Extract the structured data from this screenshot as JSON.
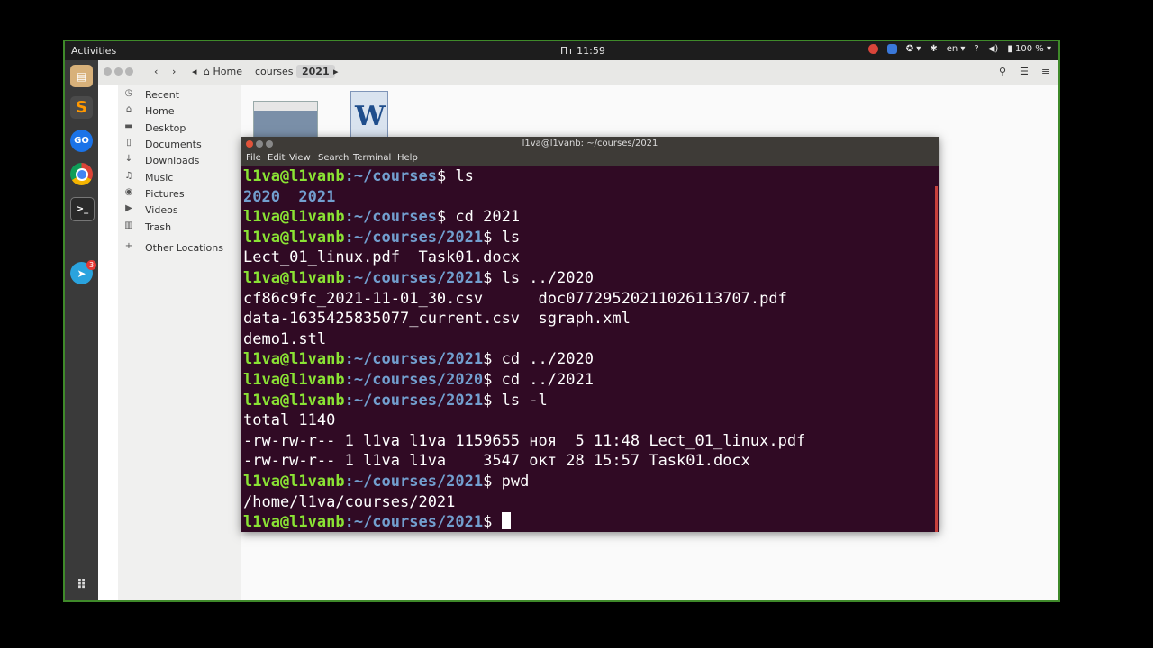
{
  "topbar": {
    "activities": "Activities",
    "clock": "Пт 11:59",
    "lang": "en",
    "help": "?",
    "battery": "100 %",
    "badge_count": "3"
  },
  "dock": {
    "telegram_badge": "3",
    "apps": [
      "files",
      "sublime-text",
      "goland",
      "chrome",
      "terminal",
      "telegram"
    ]
  },
  "files": {
    "nav": {
      "home": "Home",
      "crumbs": [
        "courses",
        "2021"
      ]
    },
    "sidebar": {
      "items": [
        {
          "label": "Recent",
          "icon": "clock-icon"
        },
        {
          "label": "Home",
          "icon": "home-icon"
        },
        {
          "label": "Desktop",
          "icon": "folder-icon"
        },
        {
          "label": "Documents",
          "icon": "document-icon"
        },
        {
          "label": "Downloads",
          "icon": "download-icon"
        },
        {
          "label": "Music",
          "icon": "music-icon"
        },
        {
          "label": "Pictures",
          "icon": "camera-icon"
        },
        {
          "label": "Videos",
          "icon": "video-icon"
        },
        {
          "label": "Trash",
          "icon": "trash-icon"
        }
      ],
      "other": "Other Locations"
    }
  },
  "terminal": {
    "title": "l1va@l1vanb: ~/courses/2021",
    "menu": [
      "File",
      "Edit",
      "View",
      "Search",
      "Terminal",
      "Help"
    ],
    "user": "l1va@l1vanb",
    "lines": [
      {
        "path": ":~/courses",
        "cmd": "$ ls"
      },
      {
        "out": "2020  2021",
        "dirs": true
      },
      {
        "path": ":~/courses",
        "cmd": "$ cd 2021"
      },
      {
        "path": ":~/courses/2021",
        "cmd": "$ ls"
      },
      {
        "out": "Lect_01_linux.pdf  Task01.docx"
      },
      {
        "path": ":~/courses/2021",
        "cmd": "$ ls ../2020"
      },
      {
        "out": "cf86c9fc_2021-11-01_30.csv      doc07729520211026113707.pdf"
      },
      {
        "out": "data-1635425835077_current.csv  sgraph.xml"
      },
      {
        "out": "demo1.stl"
      },
      {
        "path": ":~/courses/2021",
        "cmd": "$ cd ../2020"
      },
      {
        "path": ":~/courses/2020",
        "cmd": "$ cd ../2021"
      },
      {
        "path": ":~/courses/2021",
        "cmd": "$ ls -l"
      },
      {
        "out": "total 1140"
      },
      {
        "out": "-rw-rw-r-- 1 l1va l1va 1159655 ноя  5 11:48 Lect_01_linux.pdf"
      },
      {
        "out": "-rw-rw-r-- 1 l1va l1va    3547 окт 28 15:57 Task01.docx"
      },
      {
        "path": ":~/courses/2021",
        "cmd": "$ pwd"
      },
      {
        "out": "/home/l1va/courses/2021"
      },
      {
        "path": ":~/courses/2021",
        "cmd": "$ ",
        "cursor": true
      }
    ]
  }
}
